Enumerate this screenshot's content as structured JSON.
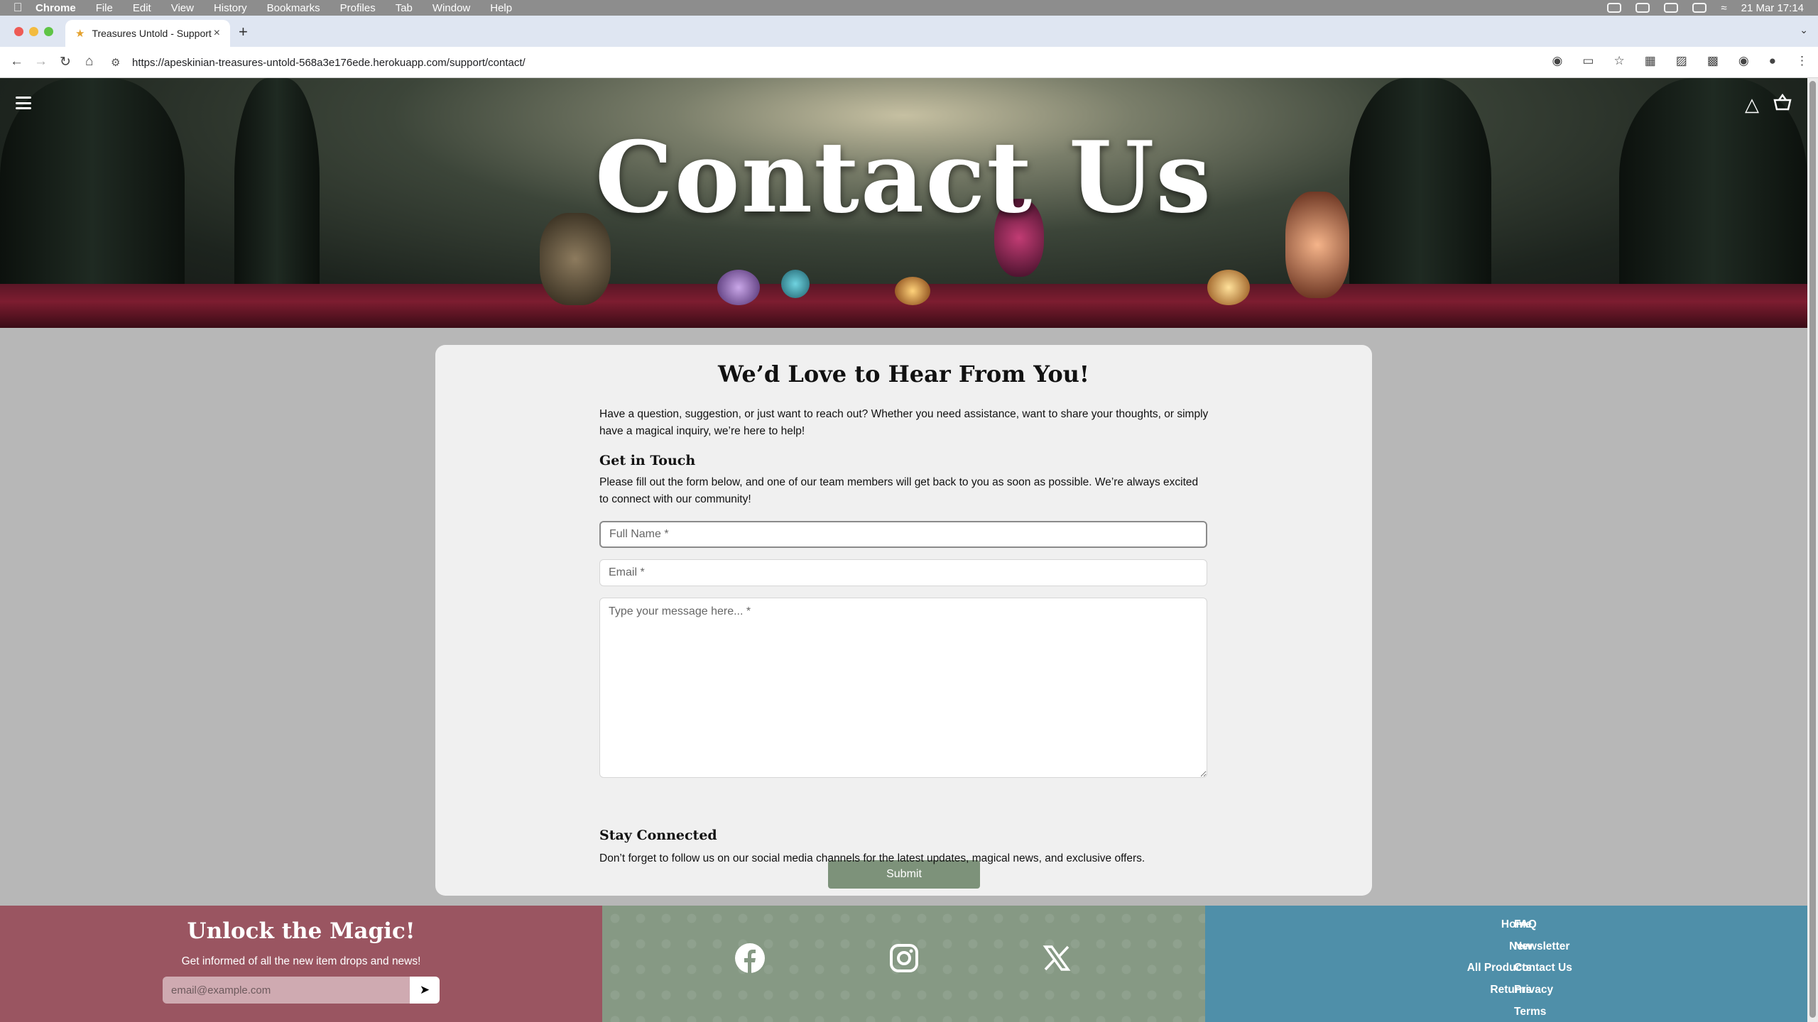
{
  "menubar": {
    "app": "Chrome",
    "items": [
      "File",
      "Edit",
      "View",
      "History",
      "Bookmarks",
      "Profiles",
      "Tab",
      "Window",
      "Help"
    ],
    "clock": "21 Mar  17:14"
  },
  "browser": {
    "tab_title": "Treasures Untold - Support",
    "url": "https://apeskinian-treasures-untold-568a3e176ede.herokuapp.com/support/contact/"
  },
  "hero": {
    "title": "Contact Us"
  },
  "card": {
    "heading": "We’d Love to Hear From You!",
    "intro": "Have a question, suggestion, or just want to reach out? Whether you need assistance, want to share your thoughts, or simply have a magical inquiry, we’re here to help!",
    "touch_heading": "Get in Touch",
    "touch_text": "Please fill out the form below, and one of our team members will get back to you as soon as possible. We’re always excited to connect with our community!",
    "form": {
      "name_placeholder": "Full Name *",
      "email_placeholder": "Email *",
      "message_placeholder": "Type your message here... *",
      "submit_label": "Submit"
    },
    "connected_heading": "Stay Connected",
    "connected_text": "Don’t forget to follow us on our social media channels for the latest updates, magical news, and exclusive offers."
  },
  "footer": {
    "newsletter_title": "Unlock the Magic!",
    "newsletter_sub": "Get informed of all the new item drops and news!",
    "newsletter_placeholder": "email@example.com",
    "social": [
      "facebook-icon",
      "instagram-icon",
      "x-icon"
    ],
    "links_left": [
      "Home",
      "New",
      "All Products",
      "Returns"
    ],
    "links_right": [
      "FAQ",
      "Newsletter",
      "Contact Us",
      "Privacy",
      "Terms"
    ]
  }
}
